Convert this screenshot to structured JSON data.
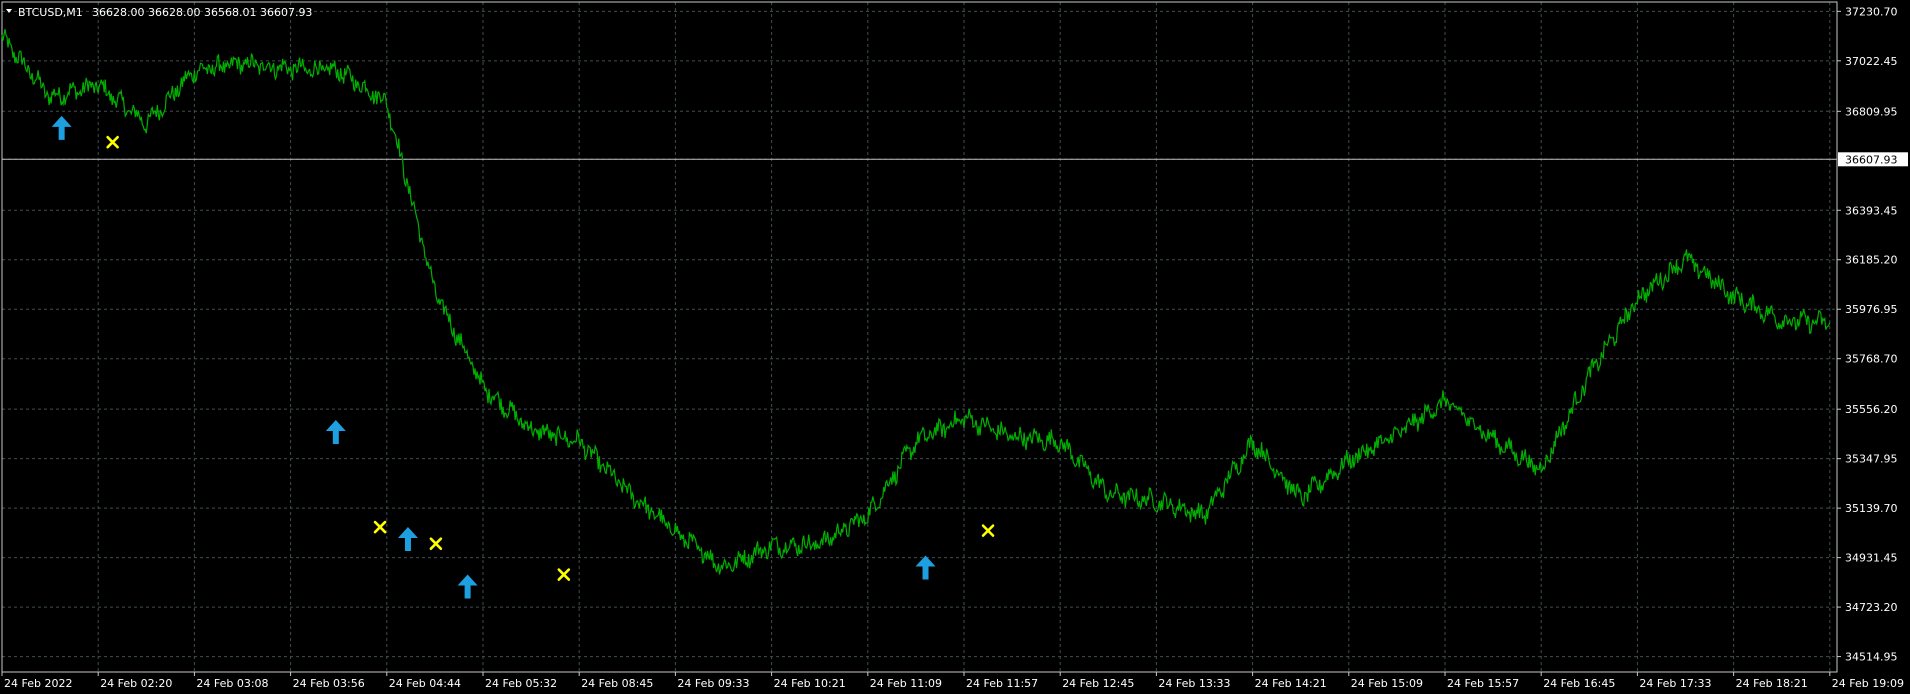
{
  "header": {
    "symbol": "BTCUSD,M1",
    "ohlc": "36628.00 36628.00 36568.01 36607.93"
  },
  "colors": {
    "background": "#000000",
    "grid": "#3f4e4f",
    "axis": "#c8c8c8",
    "price_line": "#00b000",
    "buy_arrow": "#1e9fe0",
    "close_mark": "#ffff00",
    "bid_line": "#c0c0c0",
    "text": "#ffffff"
  },
  "chart_data": {
    "type": "line",
    "title": "BTCUSD,M1",
    "price_labels": [
      "37230.70",
      "37022.45",
      "36809.95",
      "36607.93",
      "36393.45",
      "36185.20",
      "35976.95",
      "35768.70",
      "35556.20",
      "35347.95",
      "35139.70",
      "34931.45",
      "34723.20",
      "34514.95"
    ],
    "ylim": [
      34450,
      37270
    ],
    "current_price": 36607.93,
    "current_price_label": "36607.93",
    "time_labels": [
      "24 Feb 2022",
      "24 Feb 02:20",
      "24 Feb 03:08",
      "24 Feb 03:56",
      "24 Feb 04:44",
      "24 Feb 05:32",
      "24 Feb 08:45",
      "24 Feb 09:33",
      "24 Feb 10:21",
      "24 Feb 11:09",
      "24 Feb 11:57",
      "24 Feb 12:45",
      "24 Feb 13:33",
      "24 Feb 14:21",
      "24 Feb 15:09",
      "24 Feb 15:57",
      "24 Feb 16:45",
      "24 Feb 17:33",
      "24 Feb 18:21",
      "24 Feb 19:09"
    ],
    "grid": true,
    "series": [
      {
        "x": [
          0,
          0.5,
          1,
          1.5,
          2,
          2.5,
          3,
          3.5,
          4,
          4.5,
          5,
          5.5,
          6,
          6.5,
          7,
          7.5,
          8,
          8.5,
          9,
          9.5,
          10,
          10.5,
          11,
          11.5,
          12,
          12.5,
          13,
          13.5,
          14,
          14.5,
          15,
          15.5,
          16,
          16.5,
          17,
          17.5,
          18,
          18.5,
          19
        ],
        "values": [
          37120,
          36870,
          36920,
          36760,
          36980,
          37010,
          36990,
          36980,
          36850,
          36050,
          35650,
          35470,
          35420,
          35210,
          35040,
          34890,
          34980,
          34990,
          35110,
          35420,
          35520,
          35440,
          35420,
          35200,
          35170,
          35110,
          35420,
          35180,
          35340,
          35450,
          35590,
          35430,
          35300,
          35700,
          36020,
          36190,
          36030,
          35930,
          35920
        ]
      }
    ],
    "buy_arrows": [
      {
        "x": 0.62,
        "price": 36740
      },
      {
        "x": 3.47,
        "price": 35460
      },
      {
        "x": 4.22,
        "price": 35010
      },
      {
        "x": 4.84,
        "price": 34810
      },
      {
        "x": 9.6,
        "price": 34890
      }
    ],
    "close_marks": [
      {
        "x": 1.15,
        "price": 36680
      },
      {
        "x": 3.93,
        "price": 35060
      },
      {
        "x": 4.51,
        "price": 34990
      },
      {
        "x": 5.84,
        "price": 34860
      },
      {
        "x": 10.25,
        "price": 35045
      }
    ]
  }
}
